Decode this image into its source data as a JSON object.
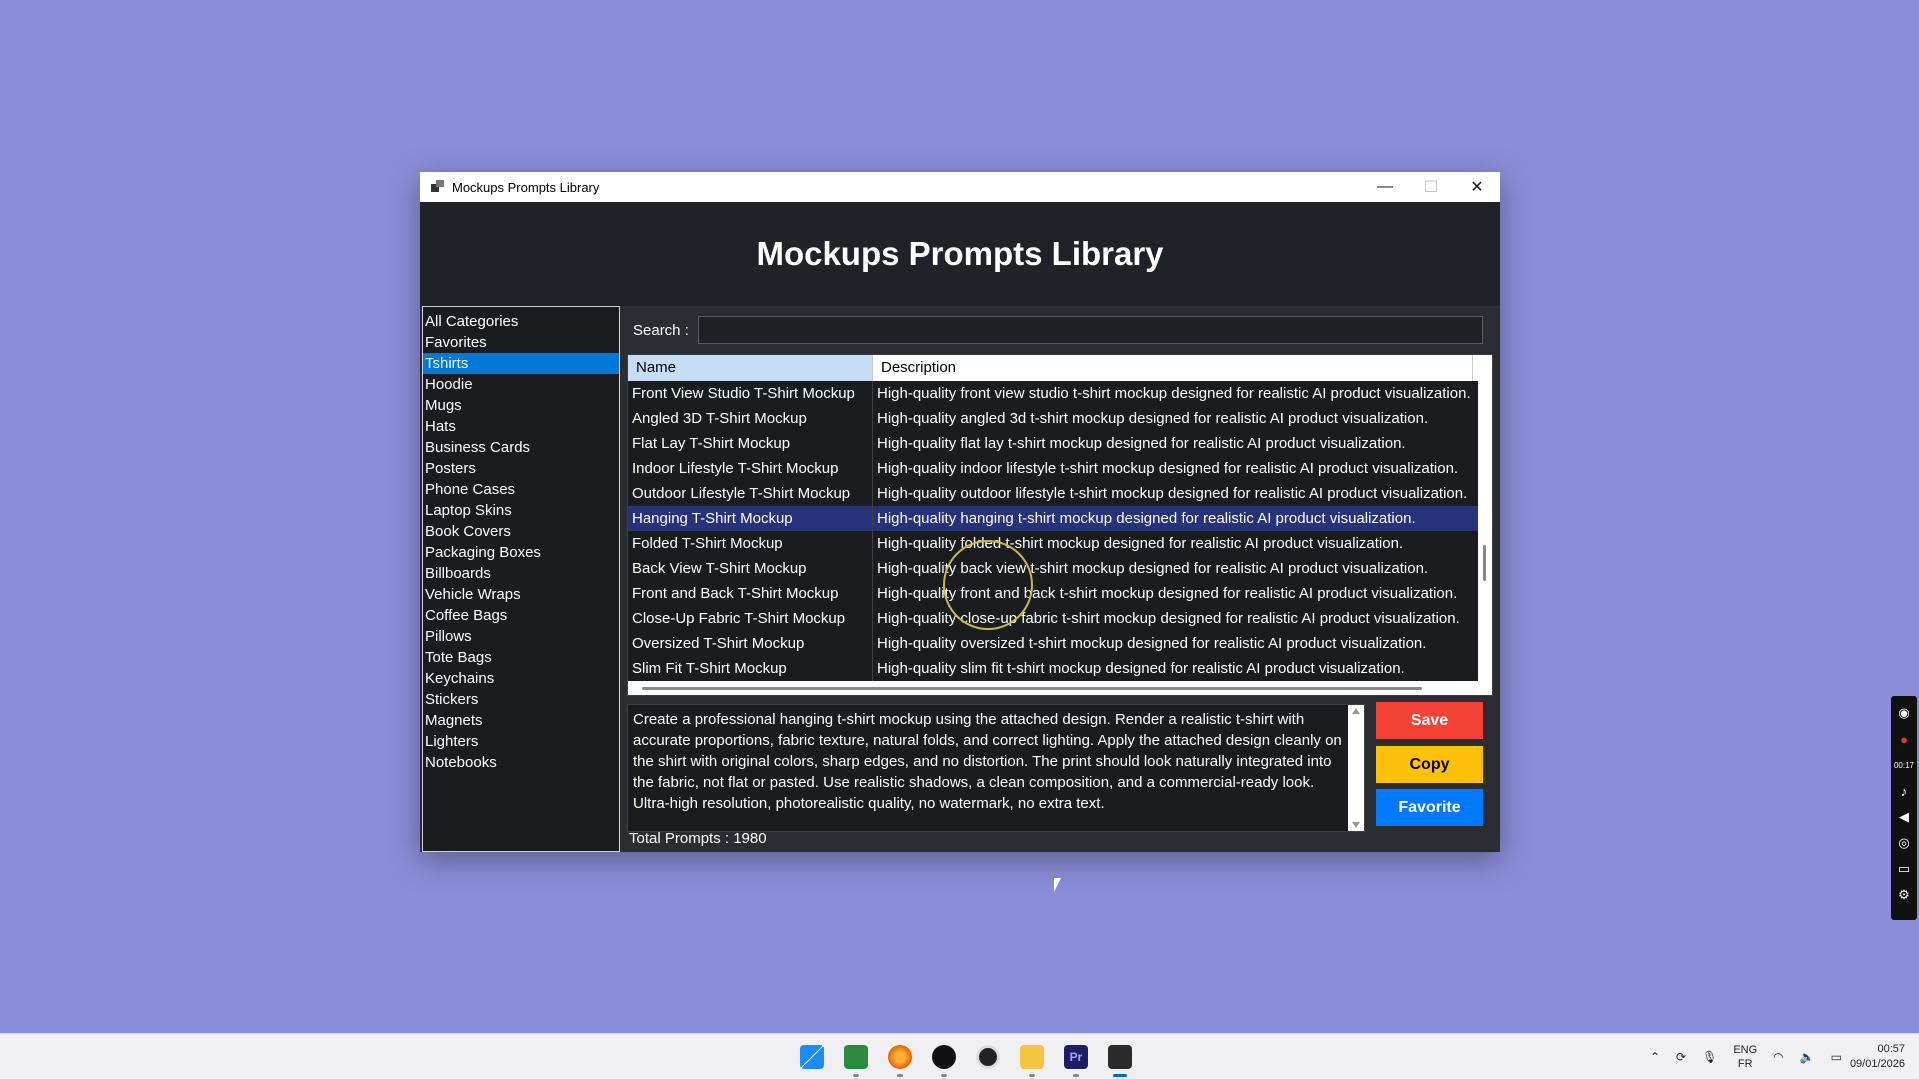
{
  "window": {
    "title": "Mockups Prompts Library",
    "minimize": "—",
    "maximize": "☐",
    "close": "✕"
  },
  "header": {
    "title": "Mockups Prompts Library"
  },
  "categories": [
    "All Categories",
    "Favorites",
    "Tshirts",
    "Hoodie",
    "Mugs",
    "Hats",
    "Business Cards",
    "Posters",
    "Phone Cases",
    "Laptop Skins",
    "Book Covers",
    "Packaging Boxes",
    "Billboards",
    "Vehicle Wraps",
    "Coffee Bags",
    "Pillows",
    "Tote Bags",
    "Keychains",
    "Stickers",
    "Magnets",
    "Lighters",
    "Notebooks"
  ],
  "selected_category": "Tshirts",
  "search": {
    "label": "Search :",
    "value": ""
  },
  "table": {
    "columns": [
      "Name",
      "Description"
    ],
    "rows": [
      [
        "Front View Studio T-Shirt Mockup",
        "High-quality front view studio t-shirt mockup designed for realistic AI product visualization."
      ],
      [
        "Angled 3D T-Shirt Mockup",
        "High-quality angled 3d t-shirt mockup designed for realistic AI product visualization."
      ],
      [
        "Flat Lay T-Shirt Mockup",
        "High-quality flat lay t-shirt mockup designed for realistic AI product visualization."
      ],
      [
        "Indoor Lifestyle T-Shirt Mockup",
        "High-quality indoor lifestyle t-shirt mockup designed for realistic AI product visualization."
      ],
      [
        "Outdoor Lifestyle T-Shirt Mockup",
        "High-quality outdoor lifestyle t-shirt mockup designed for realistic AI product visualization."
      ],
      [
        "Hanging T-Shirt Mockup",
        "High-quality hanging t-shirt mockup designed for realistic AI product visualization."
      ],
      [
        "Folded T-Shirt Mockup",
        "High-quality folded t-shirt mockup designed for realistic AI product visualization."
      ],
      [
        "Back View T-Shirt Mockup",
        "High-quality back view t-shirt mockup designed for realistic AI product visualization."
      ],
      [
        "Front and Back T-Shirt Mockup",
        "High-quality front and back t-shirt mockup designed for realistic AI product visualization."
      ],
      [
        "Close-Up Fabric T-Shirt Mockup",
        "High-quality close-up fabric t-shirt mockup designed for realistic AI product visualization."
      ],
      [
        "Oversized T-Shirt Mockup",
        "High-quality oversized t-shirt mockup designed for realistic AI product visualization."
      ],
      [
        "Slim Fit T-Shirt Mockup",
        "High-quality slim fit t-shirt mockup designed for realistic AI product visualization."
      ]
    ],
    "selected_row": 5
  },
  "prompt_text": "Create a professional hanging t-shirt mockup using the attached design. Render a realistic t-shirt with accurate proportions, fabric texture, natural folds, and correct lighting. Apply the attached design cleanly on the shirt with original colors, sharp edges, and no distortion. The print should look naturally integrated into the fabric, not flat or pasted. Use realistic shadows, a clean composition, and a commercial-ready look. Ultra-high resolution, photorealistic quality, no watermark, no extra text.",
  "buttons": {
    "save": "Save",
    "copy": "Copy",
    "favorite": "Favorite"
  },
  "total": "Total Prompts : 1980",
  "colors": {
    "save": "#f44336",
    "copy": "#ffc107",
    "favorite": "#0078ff",
    "selection": "#0078d7"
  },
  "side_toolbar": {
    "time": "00:17"
  },
  "taskbar": {
    "apps": [
      "windows-start-icon",
      "chart-app-icon",
      "firefox-icon",
      "dark-app-icon",
      "circle-app-icon",
      "file-explorer-icon",
      "premiere-icon",
      "prompts-library-icon"
    ],
    "premiere_label": "Pr",
    "lang_top": "ENG",
    "lang_bottom": "FR",
    "time": "00:57",
    "date": "09/01/2026"
  }
}
